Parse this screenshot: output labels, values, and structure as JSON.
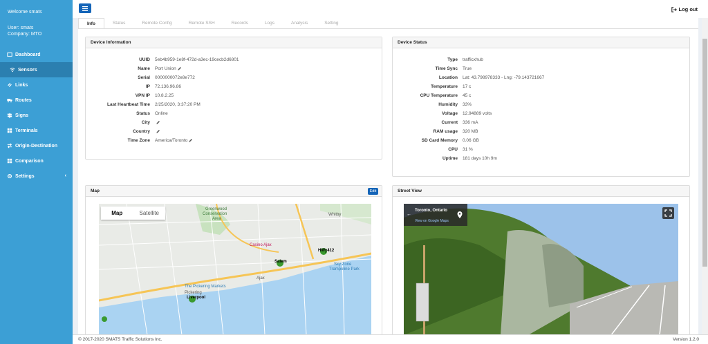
{
  "sidebar": {
    "welcome": "Welcome smats",
    "user": "User: smats",
    "company": "Company: MTO",
    "items": [
      {
        "label": "Dashboard",
        "icon": "dashboard-icon"
      },
      {
        "label": "Sensors",
        "icon": "wifi-icon"
      },
      {
        "label": "Links",
        "icon": "link-icon"
      },
      {
        "label": "Routes",
        "icon": "truck-icon"
      },
      {
        "label": "Signs",
        "icon": "signpost-icon"
      },
      {
        "label": "Terminals",
        "icon": "grid-icon"
      },
      {
        "label": "Origin-Destination",
        "icon": "arrows-icon"
      },
      {
        "label": "Comparison",
        "icon": "grid-icon"
      },
      {
        "label": "Settings",
        "icon": "gear-icon",
        "chevron": "‹"
      }
    ]
  },
  "header": {
    "logout": "Log out"
  },
  "tabs": [
    "Info",
    "Status",
    "Remote Config",
    "Remote SSH",
    "Records",
    "Logs",
    "Analysis",
    "Setting"
  ],
  "device_info": {
    "title": "Device Information",
    "rows": [
      {
        "k": "UUID",
        "v": "5eb4b959-1e8f-472d-a3ec-19cecb2d6801"
      },
      {
        "k": "Name",
        "v": "Port Union"
      },
      {
        "k": "Serial",
        "v": "0000000072e8e772"
      },
      {
        "k": "IP",
        "v": "72.136.96.86"
      },
      {
        "k": "VPN IP",
        "v": "10.8.2.25"
      },
      {
        "k": "Last Heartbeat Time",
        "v": "2/25/2020, 3:37:20 PM"
      },
      {
        "k": "Status",
        "v": "Online"
      },
      {
        "k": "City",
        "v": ""
      },
      {
        "k": "Country",
        "v": ""
      },
      {
        "k": "Time Zone",
        "v": "America/Toronto"
      }
    ]
  },
  "device_status": {
    "title": "Device Status",
    "rows": [
      {
        "k": "Type",
        "v": "trafficxhub"
      },
      {
        "k": "Time Sync",
        "v": "True"
      },
      {
        "k": "Location",
        "v": "Lat: 43.798978333 - Lng: -79.143721667"
      },
      {
        "k": "Temperature",
        "v": "17 c"
      },
      {
        "k": "CPU Temperature",
        "v": "45 c"
      },
      {
        "k": "Humidity",
        "v": "33%"
      },
      {
        "k": "Voltage",
        "v": "12.94889 volts"
      },
      {
        "k": "Current",
        "v": "336 mA"
      },
      {
        "k": "RAM usage",
        "v": "320 MB"
      },
      {
        "k": "SD Card Memory",
        "v": "0.06 GB"
      },
      {
        "k": "CPU",
        "v": "31 %"
      },
      {
        "k": "Uptime",
        "v": "181 days 10h 9m"
      }
    ]
  },
  "map_panel": {
    "title": "Map",
    "edit": "Edit",
    "toggle_map": "Map",
    "toggle_satellite": "Satellite",
    "labels": {
      "greenwood": "Greenwood",
      "conservation": "Conservation",
      "area": "Area",
      "whitby": "Whitby",
      "casino": "Casino Ajax",
      "salem": "Salem",
      "hwy412": "HWy412",
      "skyzone": "Sky Zone",
      "trampoline": "Trampoline Park",
      "ajax": "Ajax",
      "pickering_markets": "The Pickering Markets",
      "pickering": "Pickering",
      "liverpool": "Liverpool"
    }
  },
  "street_panel": {
    "title": "Street View",
    "location": "Toronto, Ontario",
    "link": "View on Google Maps"
  },
  "footer": {
    "copyright": "© 2017-2020 SMATS Traffic Solutions Inc.",
    "version": "Version 1.2.0"
  }
}
